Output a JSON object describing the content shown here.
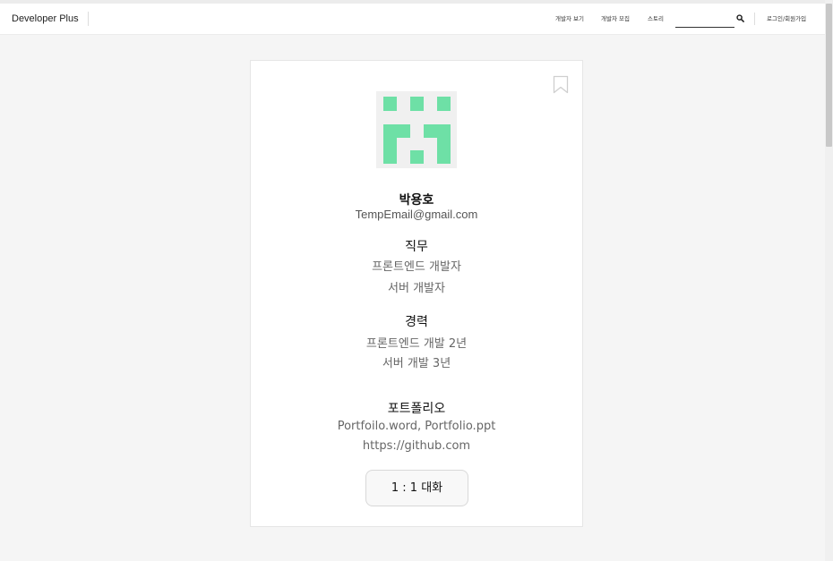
{
  "header": {
    "brand": "Developer Plus",
    "nav": {
      "view_developers": "개발자 보기",
      "recruit_developers": "개발자 모집",
      "story": "스토리",
      "login_signup": "로그인/회원가입"
    },
    "search": {
      "value": "",
      "placeholder": ""
    }
  },
  "profile": {
    "name": "박용호",
    "email": "TempEmail@gmail.com",
    "job": {
      "title": "직무",
      "items": [
        "프론트엔드 개발자",
        "서버 개발자"
      ]
    },
    "career": {
      "title": "경력",
      "items": [
        "프론트엔드 개발 2년",
        "서버 개발 3년"
      ]
    },
    "portfolio": {
      "title": "포트폴리오",
      "files": "Portfoilo.word, Portfolio.ppt",
      "link": "https://github.com"
    },
    "chat_button": "1 : 1 대화"
  },
  "colors": {
    "avatar_accent": "#6ee0a6",
    "avatar_bg": "#f0f0f0",
    "page_bg": "#f5f5f5"
  },
  "icons": {
    "search": "search-icon",
    "bookmark": "bookmark-icon"
  }
}
